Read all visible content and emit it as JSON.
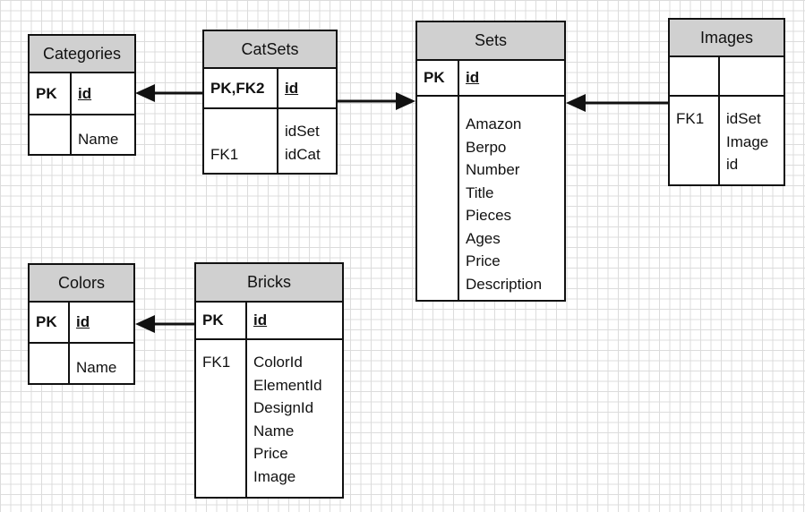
{
  "entities": [
    {
      "id": "categories",
      "title": "Categories",
      "pk_label": "PK",
      "pk_field": "id",
      "keys": [
        ""
      ],
      "fields": [
        "Name"
      ]
    },
    {
      "id": "catsets",
      "title": "CatSets",
      "pk_label": "PK,FK2",
      "pk_field": "id",
      "keys": [
        "",
        "FK1"
      ],
      "fields": [
        "idSet",
        "idCat"
      ]
    },
    {
      "id": "sets",
      "title": "Sets",
      "pk_label": "PK",
      "pk_field": "id",
      "keys": [],
      "fields": [
        "Amazon",
        "Berpo",
        "Number",
        "Title",
        "Pieces",
        "Ages",
        "Price",
        "Description"
      ]
    },
    {
      "id": "images",
      "title": "Images",
      "pk_label": "",
      "pk_field": "",
      "keys": [
        "FK1",
        "",
        ""
      ],
      "fields": [
        "idSet",
        "Image",
        "id"
      ]
    },
    {
      "id": "colors",
      "title": "Colors",
      "pk_label": "PK",
      "pk_field": "id",
      "keys": [
        ""
      ],
      "fields": [
        "Name"
      ]
    },
    {
      "id": "bricks",
      "title": "Bricks",
      "pk_label": "PK",
      "pk_field": "id",
      "keys": [
        "FK1",
        "",
        "",
        "",
        "",
        ""
      ],
      "fields": [
        "ColorId",
        "ElementId",
        "DesignId",
        "Name",
        "Price",
        "Image"
      ]
    }
  ],
  "relationships": [
    {
      "from": "catsets",
      "to": "categories"
    },
    {
      "from": "catsets",
      "to": "sets"
    },
    {
      "from": "images",
      "to": "sets"
    },
    {
      "from": "bricks",
      "to": "colors"
    }
  ],
  "colors": {
    "header": "#d0d0d0",
    "line": "#111111",
    "grid": "#dcdcdc"
  }
}
